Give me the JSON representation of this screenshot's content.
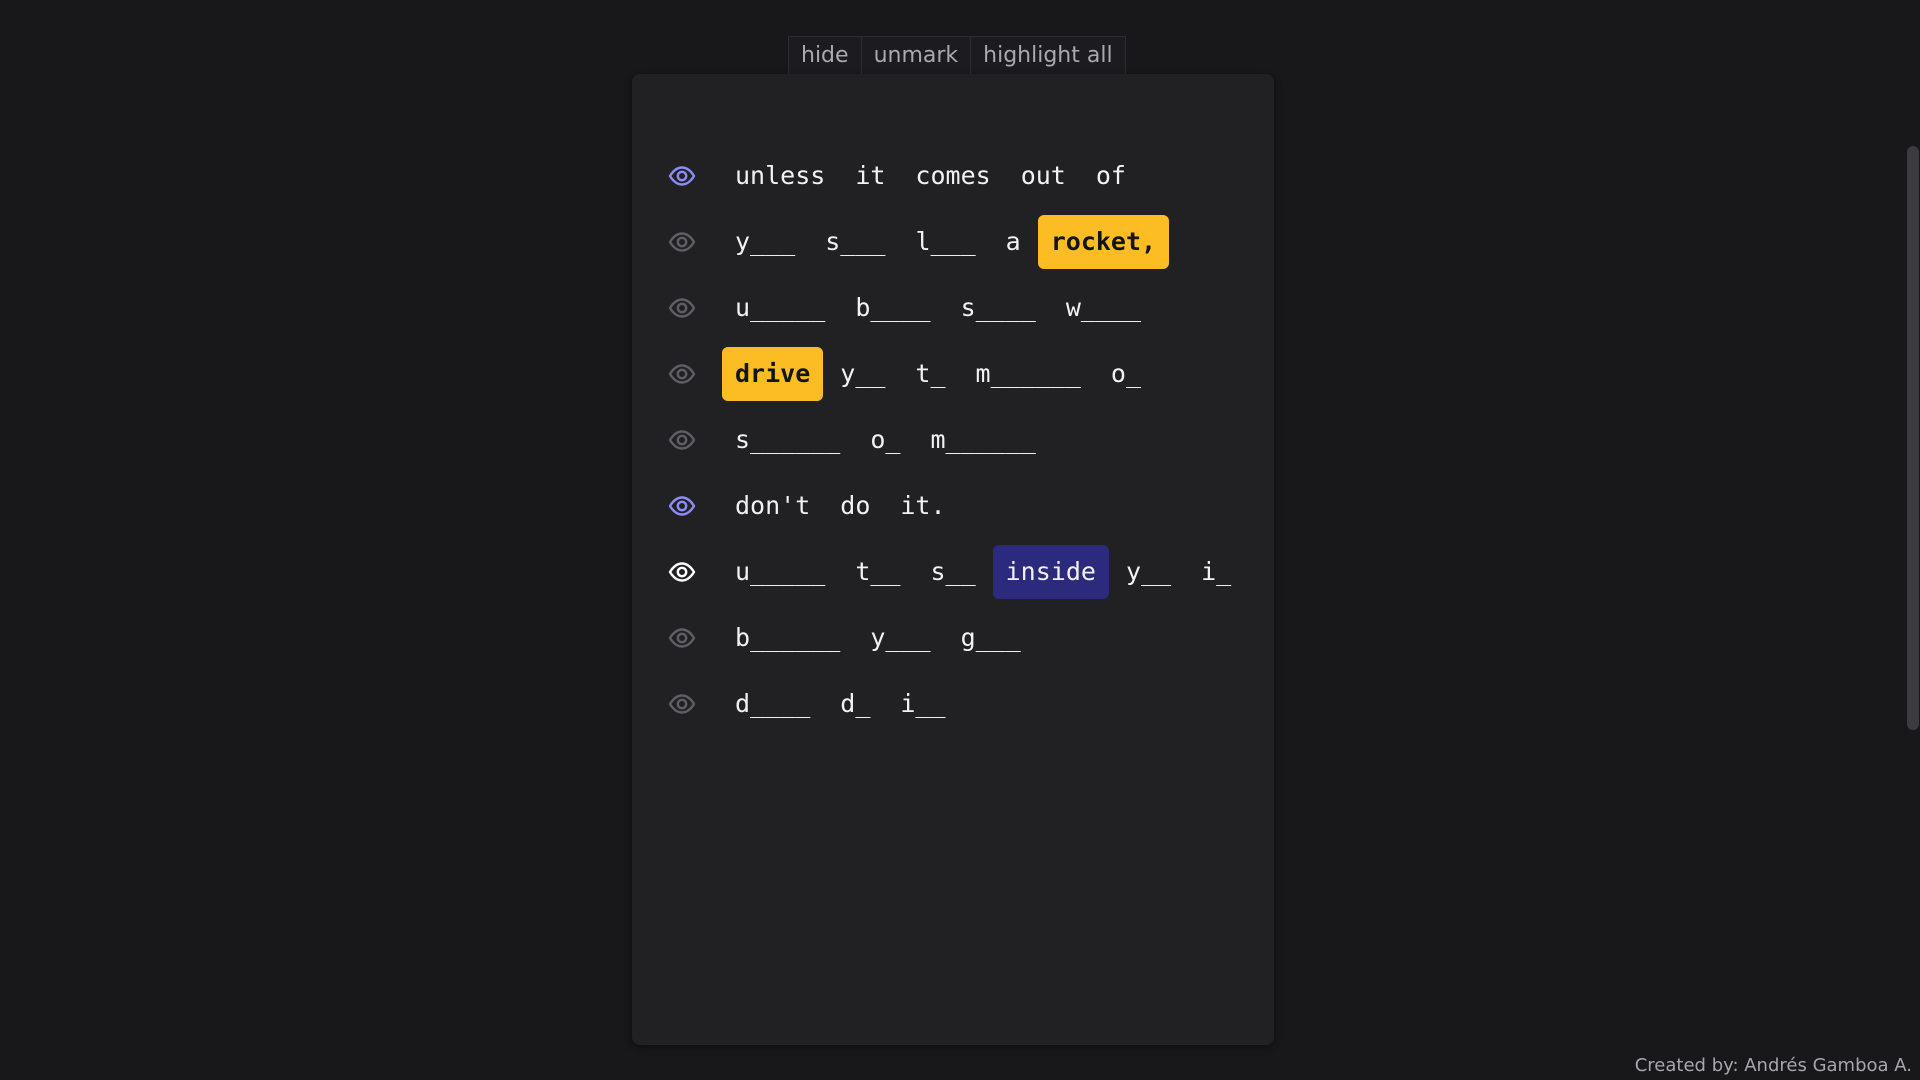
{
  "toolbar": {
    "hide_label": "hide",
    "unmark_label": "unmark",
    "highlight_all_label": "highlight all"
  },
  "colors": {
    "background": "#18181b",
    "card": "#212124",
    "highlight_yellow": "#fbbd23",
    "highlight_blue": "#2c2a7c",
    "eye_active": "#8b8cf6",
    "eye_selected": "#ffffff",
    "eye_inactive": "#5e5e63"
  },
  "lines": [
    {
      "eye_state": "active",
      "words": [
        {
          "text": "unless",
          "highlight": "none"
        },
        {
          "text": "it",
          "highlight": "none"
        },
        {
          "text": "comes",
          "highlight": "none"
        },
        {
          "text": "out",
          "highlight": "none"
        },
        {
          "text": "of",
          "highlight": "none"
        }
      ]
    },
    {
      "eye_state": "inactive",
      "words": [
        {
          "text": "y___",
          "highlight": "none"
        },
        {
          "text": "s___",
          "highlight": "none"
        },
        {
          "text": "l___",
          "highlight": "none"
        },
        {
          "text": "a",
          "highlight": "none"
        },
        {
          "text": "rocket,",
          "highlight": "yellow"
        }
      ]
    },
    {
      "eye_state": "inactive",
      "words": [
        {
          "text": "u_____",
          "highlight": "none"
        },
        {
          "text": "b____",
          "highlight": "none"
        },
        {
          "text": "s____",
          "highlight": "none"
        },
        {
          "text": "w____",
          "highlight": "none"
        }
      ]
    },
    {
      "eye_state": "inactive",
      "words": [
        {
          "text": "drive",
          "highlight": "yellow"
        },
        {
          "text": "y__",
          "highlight": "none"
        },
        {
          "text": "t_",
          "highlight": "none"
        },
        {
          "text": "m______",
          "highlight": "none"
        },
        {
          "text": "o_",
          "highlight": "none"
        }
      ]
    },
    {
      "eye_state": "inactive",
      "words": [
        {
          "text": "s______",
          "highlight": "none"
        },
        {
          "text": "o_",
          "highlight": "none"
        },
        {
          "text": "m______",
          "highlight": "none"
        }
      ]
    },
    {
      "eye_state": "active",
      "words": [
        {
          "text": "don't",
          "highlight": "none"
        },
        {
          "text": "do",
          "highlight": "none"
        },
        {
          "text": "it.",
          "highlight": "none"
        }
      ]
    },
    {
      "eye_state": "selected",
      "words": [
        {
          "text": "u_____",
          "highlight": "none"
        },
        {
          "text": "t__",
          "highlight": "none"
        },
        {
          "text": "s__",
          "highlight": "none"
        },
        {
          "text": "inside",
          "highlight": "blue"
        },
        {
          "text": "y__",
          "highlight": "none"
        },
        {
          "text": "i_",
          "highlight": "none"
        }
      ]
    },
    {
      "eye_state": "inactive",
      "words": [
        {
          "text": "b______",
          "highlight": "none"
        },
        {
          "text": "y___",
          "highlight": "none"
        },
        {
          "text": "g___",
          "highlight": "none"
        }
      ]
    },
    {
      "eye_state": "inactive",
      "words": [
        {
          "text": "d____",
          "highlight": "none"
        },
        {
          "text": "d_",
          "highlight": "none"
        },
        {
          "text": "i__",
          "highlight": "none"
        }
      ]
    }
  ],
  "footer": {
    "credit": "Created by: Andrés Gamboa A."
  }
}
